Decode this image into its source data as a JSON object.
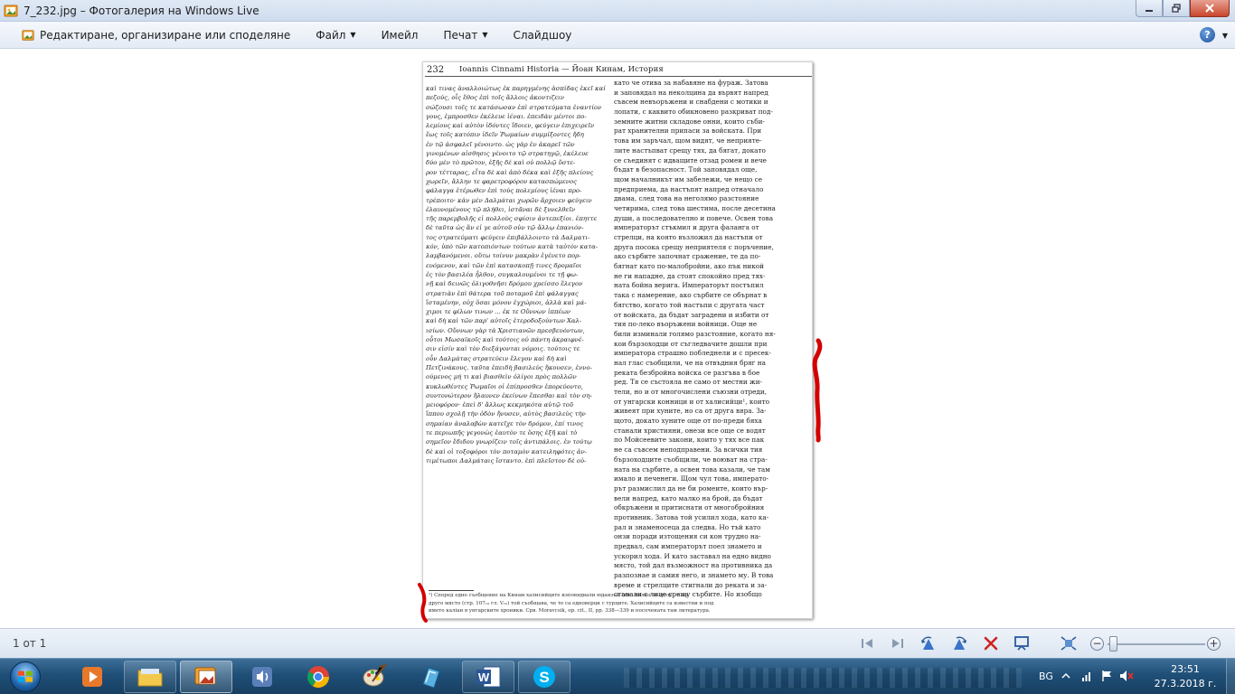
{
  "window": {
    "title": "7_232.jpg – Фотогалерия на Windows Live"
  },
  "menu": {
    "items": [
      {
        "label": "Редактиране, организиране или споделяне",
        "has_caret": false
      },
      {
        "label": "Файл",
        "has_caret": true
      },
      {
        "label": "Имейл",
        "has_caret": false
      },
      {
        "label": "Печат",
        "has_caret": true
      },
      {
        "label": "Слайдшоу",
        "has_caret": false
      }
    ],
    "help_label": "?"
  },
  "document": {
    "page_number": "232",
    "running_title": "Ioannis Cinnami Historia — Йоан Кинам, История",
    "left_column": [
      "καὶ τινας ἀναλλοιώτως ἐκ παρηγμένης ἀσπίδας ἐκεῖ καί",
      "πεζούς, οἷς ἔθος ἐπὶ τοῖς ἄλλοις ἀκοντιζειν",
      "σώζουσι τοῖς τε κατάσωσαν ἐπὶ στρατεύματα ἐναντίον",
      "γους, ἐμπροσθεν ἐκέλευε ἰέναι. ἐπειδὰν μέντοι πο-",
      "λεμίους καὶ αὐτὸν ἰδόντες ἴδοιεν, φεύγειν ἐπιχειρεῖν",
      "ἕως τοῖς κατόπιν ἰδεῖν Ῥωμαίων συμμίξοντες ἤδη",
      "ἐν τῷ ἀσφαλεῖ γένοιντο. ὡς γὰρ ἐν ἀκαρεῖ τῶν",
      "γινομένων αἰσθησις γένοιτο τῷ στρατηγῷ, ἐκέλευε",
      "δύο μὲν τὸ πρῶτον, ἑξῆς δὲ καὶ οὐ πολλῷ ὕστε-",
      "ρον τέτταρας, εἶτα δὲ καὶ ἀπὸ δέκα καὶ ἑξῆς πλείους",
      "χωρεῖν, ἄλλην τε φαρετροφόρον κατασπώμενος",
      "φάλαγγα ἑτέρωθεν ἐπὶ τοὺς πολεμίους ἰέναι προ-",
      "τρέποιτο· κἀν μὲν Δαλμάται χωρῶν ἄρχοιεν φεύγειν",
      "ἐλαυνομένους τῷ πλήθει, ἱστᾶναι δὲ ξυνελθεῖν",
      "τῆς παρεμβολῆς εἰ πολλοὺς σφίσιν ἀντεπεξίοι. ἐπηττε",
      "δὲ ταῦτα ὡς ἂν εἰ γε αὐτοῦ οὐν τῷ ἄλλῳ ἐπανιόν-",
      "τος στρατεύματι φεύγειν ἐπιβάλλοιντο τὰ Δαλματι-",
      "κόν, ὑπὸ τῶν κατοπιόντων τούτων κατὰ ταὐτὸν κατα-",
      "λαμβανόμενοι. οὕτω τοίνυν μακρὰν ἐγένετο πορ-",
      "ευόμενον, καὶ τῶν ἐπὶ κατασκοπῇ τινες δρομαῖοι",
      "ἐς τὸν βασιλέα ἦλθον, συγκαλουμένοι τε τῇ φω-",
      "νῇ καὶ δεινῶς ὀλιγοθνῆσι δρόμου χρείσσο ἔλεγον",
      "στρατιὰν ἐπὶ θάτερα τοῦ ποταμοῦ ἐπὶ φάλαγγας",
      "ἵσταμένην, οὐχ ὅσαι μόνον ἐγχώριοι, ἀλλὰ καὶ μά-",
      "χιμοι τε φίλων τινων ... ἐκ τε Οὔννων ἱππέων",
      "καὶ δὴ καὶ τῶν παρ' αὐτοῖς ἑτεροδοξούντων Χαλ-",
      "ισίων. Οὔννων γὰρ τὰ Χριστιανῶν πρεσβευόντων,",
      "οὗτοι Μωσαϊκοῖς καὶ τούτοις οὐ πάντη ἀκραιφνέ-",
      "σιν εἰσίν καὶ τὸν διεξάγονται νόμοις. τούτοις τε",
      "οὖν Δαλμάτας στρατεύειν ἔλεγον καὶ δὴ καὶ",
      "Πετζινάκους. ταῦτα ἐπειδὴ βασιλεὺς ἤκουσεν, ἐννο-",
      "ούμενος μή τι καὶ βιασθεὶν ὀλίγοι πρὸς πολλῶν",
      "κυκλωθέντες Ῥωμαῖοι οἱ ἐπίπροσθεν ἐπορεύοντο,",
      "συντονώτερον ἤλαυνεν ἐκείνων ἕπεσθαι καὶ τὸν ση-",
      "μειοφόρον· ἐπεὶ δ' ἄλλως κεκμηκότα αὐτῷ τοῦ",
      "ἵππου σχολῇ τὴν ὁδὸν ἤνυσεν, αὐτὸς βασιλεὺς τὴν",
      "σημαίαν ἀναλαβὼν κατεῖχε τὸν δρόμον, ἐπί τινος",
      "τε περιωπῆς γεγονὼς ἑαυτὸν τε ὅσης ἐξῆ καὶ τὸ",
      "σημεῖον ἔδιδου γνωρίζειν τοῖς ἀντιπάλοις. ἐν τούτῳ",
      "δὲ καὶ οἱ τοξοφόροι τὸν ποταμὸν κατειληφότες ἀν-",
      "τιμέτωποι Δαλμάταις ἵσταντο. ἐπὶ πλεῖστον δὲ οὐ-"
    ],
    "right_column": [
      "като че отива за набавяне на фураж. Затова",
      "и заповядал на неколцина да вървят напред",
      "съвсем невъоръжени и снабдени с мотики и",
      "лопати, с каквито обикновено разкриват под-",
      "земните житни складове онни, които съби-",
      "рат хранителни припаси за войската. При",
      "това им заръчал, щом видят, че неприяте-",
      "лите настъпват срещу тях, да бягат, докато",
      "се съединят с идващите отзад ромеи и вече",
      "бъдат в безопасност. Той заповядал още,",
      "щом началникът им забележи, че нещо се",
      "предприема, да настъпят напред отначало",
      "двама, след това на неголямо разстояние",
      "четирима, след това шестима, после десетина",
      "души, а последователно и повече. Освен това",
      "императорът стъкмил и друга фаланга от",
      "стрелци, на която възложил да настъпи от",
      "друга посока срещу неприятеля с поръчение,",
      "ако сърбите започнат сражение, те да по-",
      "бягнат като по-малобройни, ако пък никой",
      "не ги нападне, да стоят спокойно пред тях-",
      "ната бойна верига. Императорът постъпил",
      "така с намерение, ако сърбите се обърнат в",
      "бягство, когато той настъпи с другата част",
      "от войската, да бъдат заградени и избити от",
      "тия по-леко въоръжени войници. Още не",
      "били изминали голямо разстояние, когато ня-",
      "кои бързоходци от съгледвачите дошли при",
      "императора страшно побледнели и с пресек-",
      "нал глас съобщили, че на отвъдния бряг на",
      "реката безбройна войска се разгъва в бое",
      "ред. Тя се състояла не само от местни жи-",
      "тели, но и от многочислени съюзни отреди,",
      "от унгарски конници и от халисийци¹, които",
      "живеят при хуните, но са от друга вяра. За-",
      "щото, докато хуните още от по-преди бяха",
      "станали християни, онези все още се водят",
      "по Мойсеевите закони, които у тях все пак",
      "не са съвсем неподправени. За всички тия",
      "бързоходците съобщили, че воюват на стра-",
      "ната на сърбите, а освен това казали, че там",
      "имало и печенеги. Щом чул това, императо-",
      "рът размислил да не би ромеите, които вър-",
      "вели напред, като малко на брой, да бъдат",
      "обкръжени и притиснати от многобройния",
      "противник. Затова той усилил хода, като ка-",
      "рал и знаменосеца да следва. Но тъй като",
      "онзи поради изтощения си кон трудно на-",
      "предвал, сам императорът поел знамето и",
      "ускорил хода. И като заставал на едно видно",
      "място, той дал възможност на противника да",
      "разпознае и самия него, и знамето му. В това",
      "време и стрелците стигнали до реката и за-",
      "станали с лице срещу сърбите. Но изобщо"
    ],
    "footnote": [
      "¹) Според едно съобщение на Кинам халисийците изповядвали юдаизъм (вж. малко по-долу), а на",
      "друго място (стр. 107₁₀ гл. V₁₆) той съобщава, че те са еднoверци с турците. Халисийците са известни и под",
      "името каліан в унгарските хроники. Срв. Moravcsik, op. cit., II, pp. 338—339 и посочената там литература."
    ]
  },
  "status": {
    "counter": "1 от 1"
  },
  "taskbar": {
    "language": "BG",
    "time": "23:51",
    "date": "27.3.2018 г."
  },
  "colors": {
    "accent_red": "#d40000",
    "titlebar": "#dbe6f3",
    "taskbar": "#1f4f77"
  }
}
